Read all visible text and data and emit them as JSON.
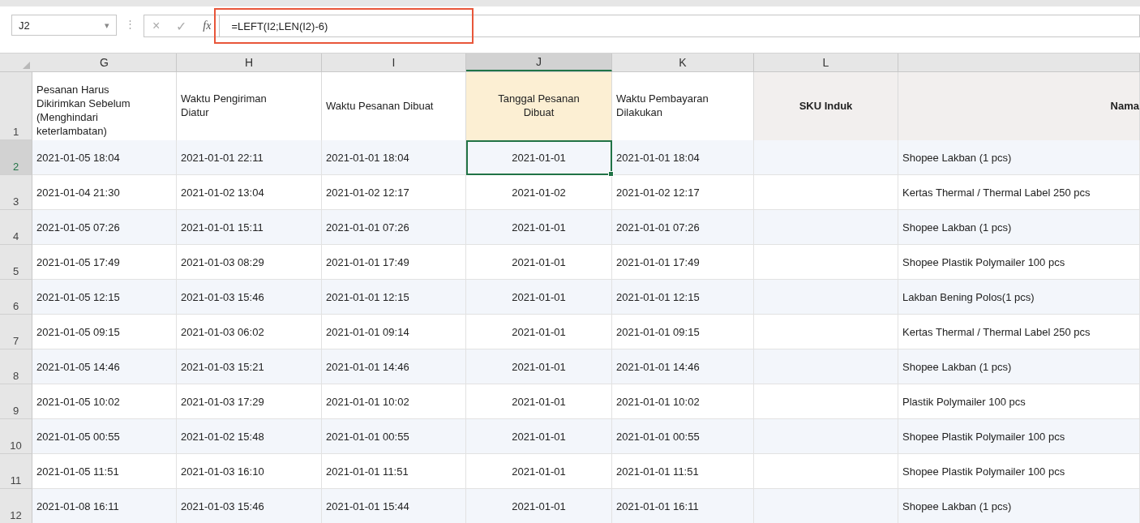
{
  "formula_bar": {
    "name_box": "J2",
    "name_box_caret": "▾",
    "separator": "⋮",
    "cancel": "×",
    "enter": "✓",
    "function": "fx",
    "formula": "=LEFT(I2;LEN(I2)-6)",
    "highlighted": true
  },
  "columns": [
    {
      "letter": "G",
      "header": "Pesanan Harus Dikirimkan Sebelum (Menghindari keterlambatan)",
      "kind": "plain",
      "selected": false
    },
    {
      "letter": "H",
      "header": "Waktu Pengiriman Diatur",
      "kind": "plain",
      "selected": false
    },
    {
      "letter": "I",
      "header": "Waktu Pesanan Dibuat",
      "kind": "plain",
      "selected": false
    },
    {
      "letter": "J",
      "header": "Tanggal Pesanan Dibuat",
      "kind": "highlight",
      "selected": true
    },
    {
      "letter": "K",
      "header": "Waktu Pembayaran Dilakukan",
      "kind": "plain",
      "selected": false
    },
    {
      "letter": "L",
      "header": "SKU Induk",
      "kind": "bold",
      "selected": false
    },
    {
      "header": "Nama",
      "kind": "bold",
      "selected": false
    }
  ],
  "header_row": "1",
  "rows": [
    {
      "number": "2",
      "selected": true,
      "cells": [
        "2021-01-05 18:04",
        "2021-01-01 22:11",
        "2021-01-01 18:04",
        "2021-01-01",
        "2021-01-01 18:04",
        null,
        "Shopee Lakban (1 pcs)"
      ]
    },
    {
      "number": "3",
      "selected": false,
      "cells": [
        "2021-01-04 21:30",
        "2021-01-02 13:04",
        "2021-01-02 12:17",
        "2021-01-02",
        "2021-01-02 12:17",
        null,
        "Kertas Thermal / Thermal Label 250 pcs"
      ]
    },
    {
      "number": "4",
      "selected": false,
      "cells": [
        "2021-01-05 07:26",
        "2021-01-01 15:11",
        "2021-01-01 07:26",
        "2021-01-01",
        "2021-01-01 07:26",
        null,
        "Shopee Lakban (1 pcs)"
      ]
    },
    {
      "number": "5",
      "selected": false,
      "cells": [
        "2021-01-05 17:49",
        "2021-01-03 08:29",
        "2021-01-01 17:49",
        "2021-01-01",
        "2021-01-01 17:49",
        null,
        "Shopee Plastik Polymailer 100 pcs"
      ]
    },
    {
      "number": "6",
      "selected": false,
      "cells": [
        "2021-01-05 12:15",
        "2021-01-03 15:46",
        "2021-01-01 12:15",
        "2021-01-01",
        "2021-01-01 12:15",
        null,
        "Lakban Bening Polos(1 pcs)"
      ]
    },
    {
      "number": "7",
      "selected": false,
      "cells": [
        "2021-01-05 09:15",
        "2021-01-03 06:02",
        "2021-01-01 09:14",
        "2021-01-01",
        "2021-01-01 09:15",
        null,
        "Kertas Thermal / Thermal Label 250 pcs"
      ]
    },
    {
      "number": "8",
      "selected": false,
      "cells": [
        "2021-01-05 14:46",
        "2021-01-03 15:21",
        "2021-01-01 14:46",
        "2021-01-01",
        "2021-01-01 14:46",
        null,
        "Shopee Lakban (1 pcs)"
      ]
    },
    {
      "number": "9",
      "selected": false,
      "cells": [
        "2021-01-05 10:02",
        "2021-01-03 17:29",
        "2021-01-01 10:02",
        "2021-01-01",
        "2021-01-01 10:02",
        null,
        "Plastik Polymailer 100 pcs"
      ]
    },
    {
      "number": "10",
      "selected": false,
      "cells": [
        "2021-01-05 00:55",
        "2021-01-02 15:48",
        "2021-01-01 00:55",
        "2021-01-01",
        "2021-01-01 00:55",
        null,
        "Shopee Plastik Polymailer 100 pcs"
      ]
    },
    {
      "number": "11",
      "selected": false,
      "cells": [
        "2021-01-05 11:51",
        "2021-01-03 16:10",
        "2021-01-01 11:51",
        "2021-01-01",
        "2021-01-01 11:51",
        null,
        "Shopee Plastik Polymailer 100 pcs"
      ]
    },
    {
      "number": "12",
      "selected": false,
      "cells": [
        "2021-01-08 16:11",
        "2021-01-03 15:46",
        "2021-01-01 15:44",
        "2021-01-01",
        "2021-01-01 16:11",
        null,
        "Shopee Lakban (1 pcs)"
      ]
    }
  ]
}
